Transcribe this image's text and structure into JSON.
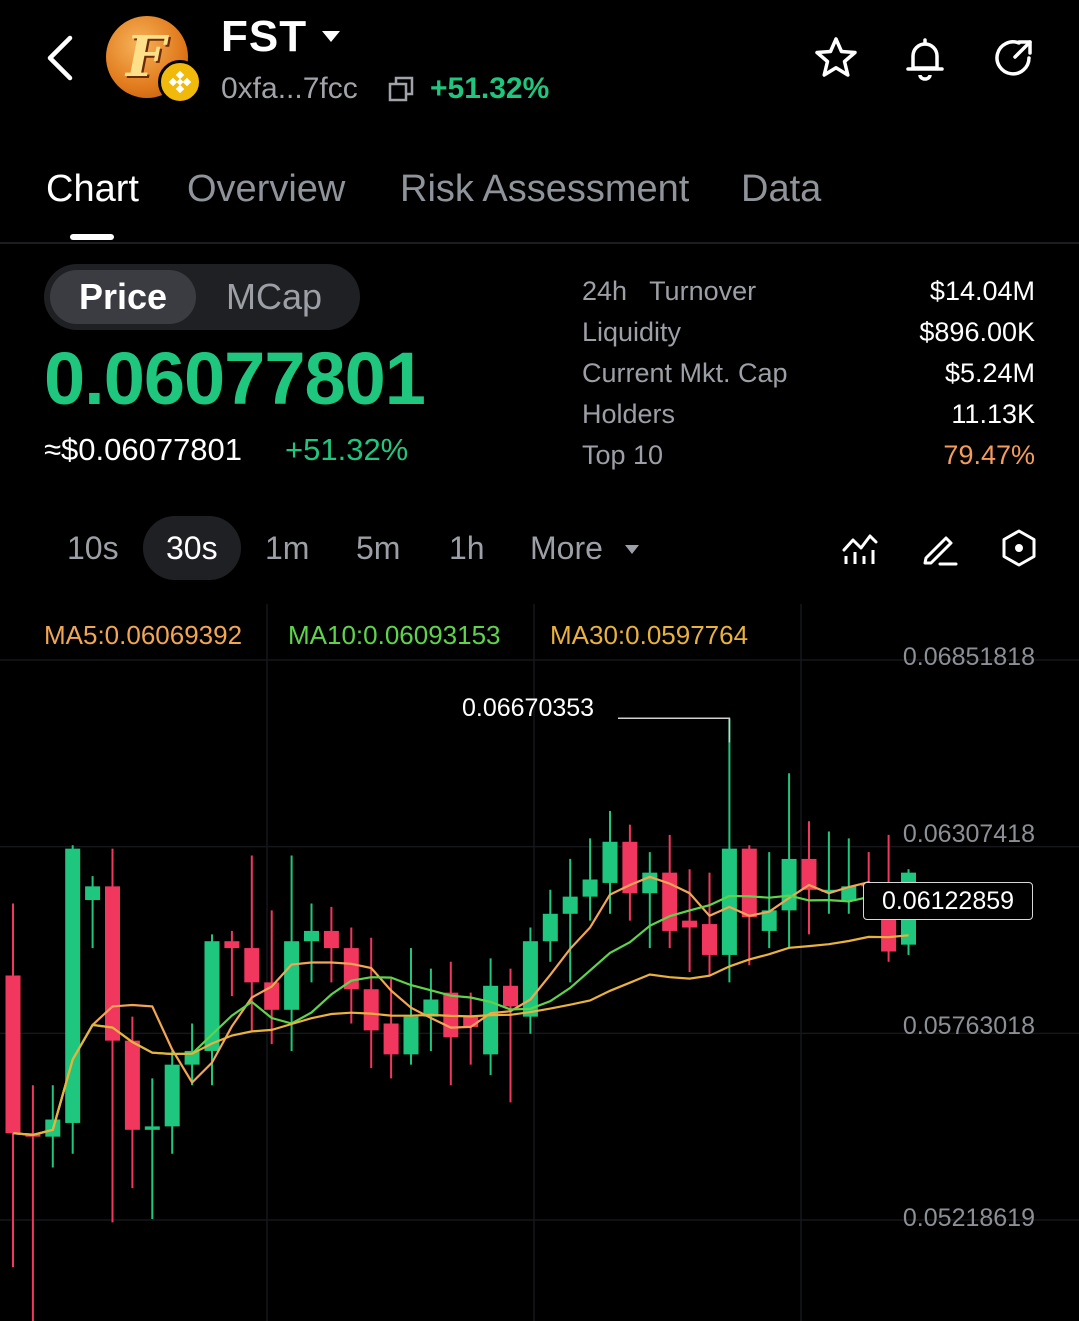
{
  "header": {
    "token_name": "FST",
    "address": "0xfa...7fcc",
    "change": "+51.32%",
    "icons": [
      "back-icon",
      "star-icon",
      "bell-icon",
      "share-icon",
      "copy-icon",
      "caret-down-icon"
    ]
  },
  "tabs": [
    {
      "label": "Chart",
      "active": true
    },
    {
      "label": "Overview",
      "active": false
    },
    {
      "label": "Risk Assessment",
      "active": false
    },
    {
      "label": "Data",
      "active": false
    }
  ],
  "price_toggle": {
    "price_label": "Price",
    "mcap_label": "MCap",
    "selected": "Price"
  },
  "price": {
    "value": "0.06077801",
    "usd": "≈$0.06077801",
    "change": "+51.32%"
  },
  "stats": [
    {
      "label": "24h   Turnover",
      "value": "$14.04M"
    },
    {
      "label": "Liquidity",
      "value": "$896.00K"
    },
    {
      "label": "Current Mkt. Cap",
      "value": "$5.24M"
    },
    {
      "label": "Holders",
      "value": "11.13K"
    },
    {
      "label": "Top 10",
      "value": "79.47%"
    }
  ],
  "intervals": {
    "items": [
      "10s",
      "30s",
      "1m",
      "5m",
      "1h"
    ],
    "selected": "30s",
    "more_label": "More"
  },
  "chart_toolbar_icons": [
    "indicator-icon",
    "draw-icon",
    "settings-hexagon-icon"
  ],
  "colors": {
    "up": "#1fc77e",
    "down": "#f2375f",
    "ma5": "#f2a654",
    "ma10": "#5fd44b",
    "ma30": "#e9b23c",
    "top10_value": "#f39c5c"
  },
  "chart_data": {
    "type": "candlestick",
    "ma_legend": {
      "ma5": "MA5:0.06069392",
      "ma10": "MA10:0.06093153",
      "ma30": "MA30:0.0597764"
    },
    "y_axis_ticks": [
      "0.06851818",
      "0.06307418",
      "0.05763018",
      "0.05218619"
    ],
    "y_axis_values": [
      0.06851818,
      0.06307418,
      0.05763018,
      0.05218619
    ],
    "current_price_label": "0.06122859",
    "current_price": 0.06122859,
    "peak_label": "0.06670353",
    "peak_value": 0.06670353,
    "candles": [
      {
        "o": 0.0592,
        "c": 0.0546,
        "h": 0.0613,
        "l": 0.0507
      },
      {
        "o": 0.0546,
        "c": 0.0545,
        "h": 0.056,
        "l": 0.049
      },
      {
        "o": 0.0545,
        "c": 0.055,
        "h": 0.056,
        "l": 0.0536
      },
      {
        "o": 0.0549,
        "c": 0.0629,
        "h": 0.063,
        "l": 0.054
      },
      {
        "o": 0.0614,
        "c": 0.0618,
        "h": 0.0621,
        "l": 0.06
      },
      {
        "o": 0.0618,
        "c": 0.0573,
        "h": 0.0629,
        "l": 0.052
      },
      {
        "o": 0.0573,
        "c": 0.0547,
        "h": 0.058,
        "l": 0.053
      },
      {
        "o": 0.0547,
        "c": 0.0548,
        "h": 0.0562,
        "l": 0.0521
      },
      {
        "o": 0.0548,
        "c": 0.0566,
        "h": 0.057,
        "l": 0.054
      },
      {
        "o": 0.0566,
        "c": 0.057,
        "h": 0.0578,
        "l": 0.056
      },
      {
        "o": 0.057,
        "c": 0.0602,
        "h": 0.0604,
        "l": 0.056
      },
      {
        "o": 0.0602,
        "c": 0.06,
        "h": 0.0605,
        "l": 0.0586
      },
      {
        "o": 0.06,
        "c": 0.059,
        "h": 0.0627,
        "l": 0.0576
      },
      {
        "o": 0.059,
        "c": 0.0582,
        "h": 0.0611,
        "l": 0.0572
      },
      {
        "o": 0.0582,
        "c": 0.0602,
        "h": 0.0627,
        "l": 0.057
      },
      {
        "o": 0.0602,
        "c": 0.0605,
        "h": 0.0613,
        "l": 0.059
      },
      {
        "o": 0.0605,
        "c": 0.06,
        "h": 0.0612,
        "l": 0.059
      },
      {
        "o": 0.06,
        "c": 0.0588,
        "h": 0.0606,
        "l": 0.0578
      },
      {
        "o": 0.0588,
        "c": 0.0576,
        "h": 0.0603,
        "l": 0.0565
      },
      {
        "o": 0.0578,
        "c": 0.0569,
        "h": 0.0591,
        "l": 0.0562
      },
      {
        "o": 0.0569,
        "c": 0.058,
        "h": 0.06,
        "l": 0.0566
      },
      {
        "o": 0.058,
        "c": 0.0585,
        "h": 0.0594,
        "l": 0.057
      },
      {
        "o": 0.0587,
        "c": 0.0574,
        "h": 0.0596,
        "l": 0.056
      },
      {
        "o": 0.058,
        "c": 0.0577,
        "h": 0.0587,
        "l": 0.0566
      },
      {
        "o": 0.0569,
        "c": 0.0589,
        "h": 0.0597,
        "l": 0.0563
      },
      {
        "o": 0.0589,
        "c": 0.0583,
        "h": 0.0594,
        "l": 0.0555
      },
      {
        "o": 0.058,
        "c": 0.0602,
        "h": 0.0606,
        "l": 0.0575
      },
      {
        "o": 0.0602,
        "c": 0.061,
        "h": 0.0617,
        "l": 0.0596
      },
      {
        "o": 0.061,
        "c": 0.0615,
        "h": 0.0626,
        "l": 0.059
      },
      {
        "o": 0.0615,
        "c": 0.062,
        "h": 0.0632,
        "l": 0.0608
      },
      {
        "o": 0.0619,
        "c": 0.0631,
        "h": 0.064,
        "l": 0.061
      },
      {
        "o": 0.0631,
        "c": 0.0616,
        "h": 0.0636,
        "l": 0.0608
      },
      {
        "o": 0.0616,
        "c": 0.0622,
        "h": 0.0628,
        "l": 0.06
      },
      {
        "o": 0.0622,
        "c": 0.0605,
        "h": 0.0633,
        "l": 0.06
      },
      {
        "o": 0.0608,
        "c": 0.0606,
        "h": 0.0623,
        "l": 0.0593
      },
      {
        "o": 0.0607,
        "c": 0.0598,
        "h": 0.0622,
        "l": 0.0592
      },
      {
        "o": 0.0598,
        "c": 0.0629,
        "h": 0.0667,
        "l": 0.059
      },
      {
        "o": 0.0629,
        "c": 0.0609,
        "h": 0.063,
        "l": 0.0595
      },
      {
        "o": 0.0605,
        "c": 0.0611,
        "h": 0.0628,
        "l": 0.06
      },
      {
        "o": 0.0611,
        "c": 0.0626,
        "h": 0.0651,
        "l": 0.06
      },
      {
        "o": 0.0626,
        "c": 0.0617,
        "h": 0.0637,
        "l": 0.0604
      },
      {
        "o": 0.0617,
        "c": 0.0617,
        "h": 0.0634,
        "l": 0.061
      },
      {
        "o": 0.0614,
        "c": 0.0618,
        "h": 0.0632,
        "l": 0.061
      },
      {
        "o": 0.0619,
        "c": 0.0618,
        "h": 0.0628,
        "l": 0.0612
      },
      {
        "o": 0.0617,
        "c": 0.0599,
        "h": 0.0633,
        "l": 0.0596
      },
      {
        "o": 0.0601,
        "c": 0.0622,
        "h": 0.0623,
        "l": 0.0598
      }
    ]
  }
}
